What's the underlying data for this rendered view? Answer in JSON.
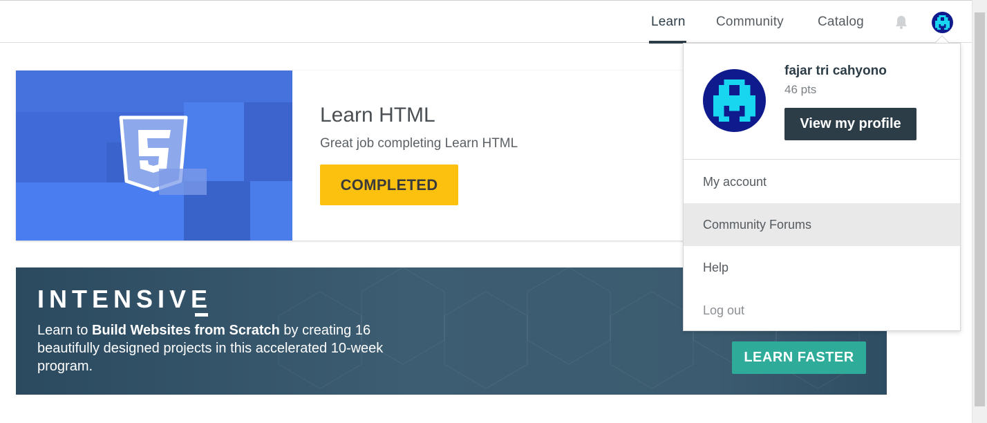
{
  "nav": {
    "items": [
      {
        "label": "Learn",
        "active": true
      },
      {
        "label": "Community",
        "active": false
      },
      {
        "label": "Catalog",
        "active": false
      }
    ],
    "bell_icon": "bell-icon",
    "avatar_icon": "pixel-robot-avatar"
  },
  "course": {
    "title": "Learn HTML",
    "subtitle": "Great job completing Learn HTML",
    "status_button": "COMPLETED",
    "image_icon": "html5-icon"
  },
  "promo": {
    "title": "INTENSIVE",
    "text_before": "Learn to ",
    "text_bold": "Build Websites from Scratch",
    "text_after": " by creating 16 beautifully designed projects in this accelerated 10-week program.",
    "button": "LEARN FASTER"
  },
  "user_menu": {
    "name": "fajar tri cahyono",
    "points": "46 pts",
    "profile_button": "View my profile",
    "items": [
      {
        "label": "My account"
      },
      {
        "label": "Community Forums",
        "hovered": true
      },
      {
        "label": "Help"
      },
      {
        "label": "Log out"
      }
    ]
  },
  "colors": {
    "brand_dark": "#2d3d47",
    "completed_yellow": "#fcc10f",
    "learn_faster_teal": "#2fac99",
    "course_blue": "#3e69d6",
    "avatar_navy": "#0f1a8c",
    "avatar_cyan": "#19d6f0"
  }
}
